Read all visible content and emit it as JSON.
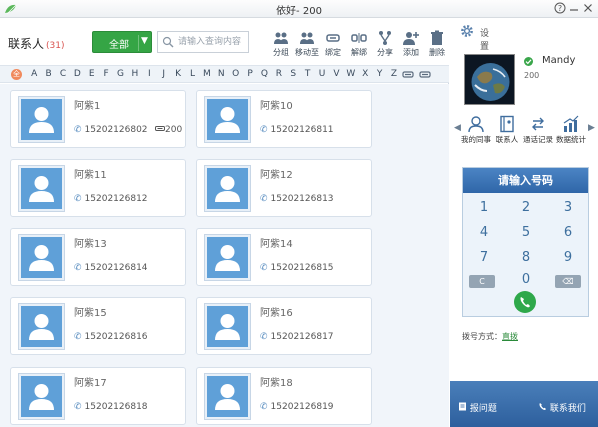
{
  "window": {
    "title": "依好- 200",
    "help_icon": "help-icon",
    "minimize_icon": "minimize-icon",
    "close_icon": "close-icon"
  },
  "toolbar": {
    "contacts_label": "联系人",
    "contacts_count": "(31)",
    "filter_label": "全部",
    "search_placeholder": "请输入查询内容",
    "tools": [
      {
        "label": "分组",
        "icon": "group-icon"
      },
      {
        "label": "移动至",
        "icon": "move-icon"
      },
      {
        "label": "绑定",
        "icon": "bind-icon"
      },
      {
        "label": "解绑",
        "icon": "unbind-icon"
      },
      {
        "label": "分享",
        "icon": "share-icon"
      },
      {
        "label": "添加",
        "icon": "add-user-icon"
      },
      {
        "label": "删除",
        "icon": "delete-icon"
      }
    ]
  },
  "alphabet": {
    "first": "全",
    "letters": [
      "A",
      "B",
      "C",
      "D",
      "E",
      "F",
      "G",
      "H",
      "I",
      "J",
      "K",
      "L",
      "M",
      "N",
      "O",
      "P",
      "Q",
      "R",
      "S",
      "T",
      "U",
      "V",
      "W",
      "X",
      "Y",
      "Z"
    ]
  },
  "contacts": [
    {
      "name": "阿紫1",
      "phone": "15202126802",
      "group": "200"
    },
    {
      "name": "阿紫10",
      "phone": "15202126811",
      "group": ""
    },
    {
      "name": "阿紫11",
      "phone": "15202126812",
      "group": ""
    },
    {
      "name": "阿紫12",
      "phone": "15202126813",
      "group": ""
    },
    {
      "name": "阿紫13",
      "phone": "15202126814",
      "group": ""
    },
    {
      "name": "阿紫14",
      "phone": "15202126815",
      "group": ""
    },
    {
      "name": "阿紫15",
      "phone": "15202126816",
      "group": ""
    },
    {
      "name": "阿紫16",
      "phone": "15202126817",
      "group": ""
    },
    {
      "name": "阿紫17",
      "phone": "15202126818",
      "group": ""
    },
    {
      "name": "阿紫18",
      "phone": "15202126819",
      "group": ""
    }
  ],
  "side": {
    "settings_label": "设置",
    "user_name": "Mandy",
    "user_id": "200",
    "nav": [
      {
        "label": "我的同事",
        "icon": "colleague-icon"
      },
      {
        "label": "联系人",
        "icon": "contacts-book-icon"
      },
      {
        "label": "通话记录",
        "icon": "call-log-icon"
      },
      {
        "label": "数据统计",
        "icon": "statistics-icon"
      }
    ],
    "dialpad": {
      "header": "请输入号码",
      "keys": [
        "1",
        "2",
        "3",
        "4",
        "5",
        "6",
        "7",
        "8",
        "9",
        "C",
        "0",
        "⌫"
      ]
    },
    "dial_mode_label": "拨号方式：",
    "dial_mode_value": "直拨",
    "footer_left": "报问题",
    "footer_right": "联系我们"
  }
}
